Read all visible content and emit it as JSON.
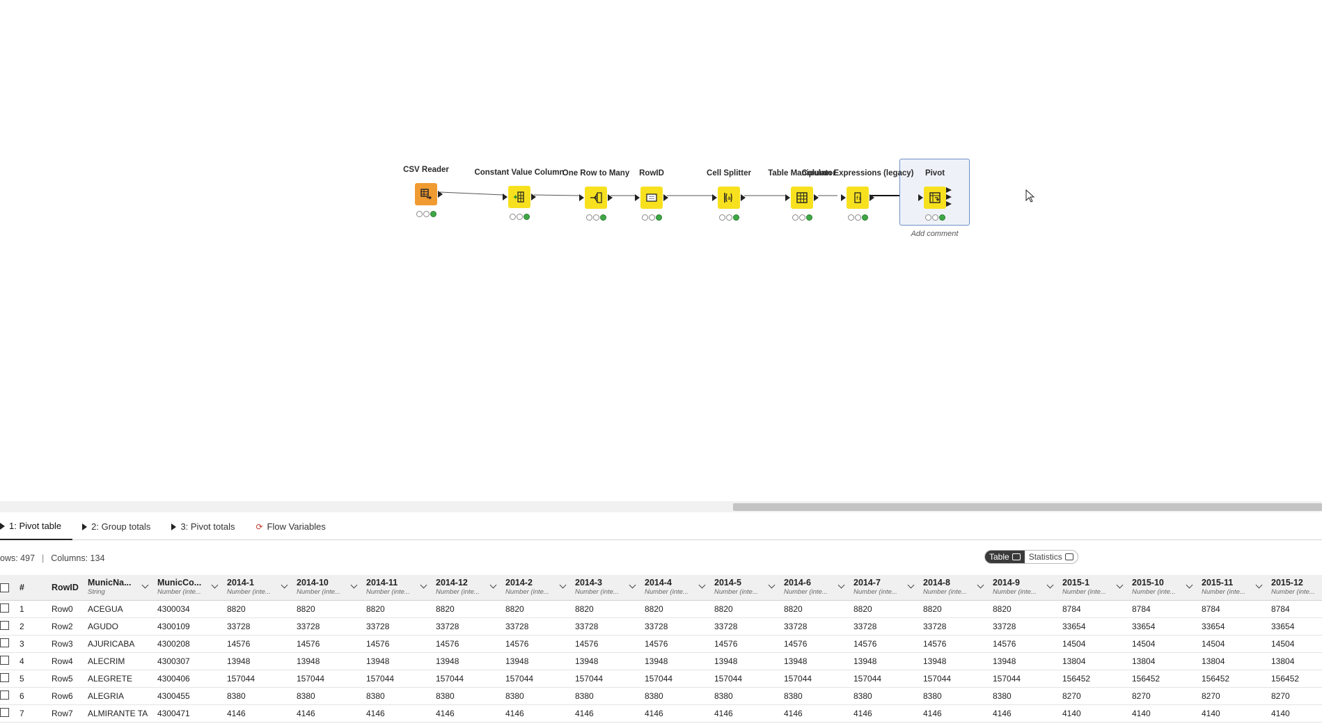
{
  "workflow": {
    "nodes": [
      {
        "id": "csv-reader",
        "title": "CSV Reader",
        "kind": "source",
        "icon": "csv-reader-icon",
        "status": [
          "idle",
          "idle",
          "ok"
        ]
      },
      {
        "id": "constant-value-column",
        "title": "Constant Value Column",
        "kind": "manipulator",
        "icon": "constant-value-icon",
        "status": [
          "idle",
          "idle",
          "ok"
        ]
      },
      {
        "id": "one-row-to-many",
        "title": "One Row to Many",
        "kind": "manipulator",
        "icon": "one-row-to-many-icon",
        "status": [
          "idle",
          "idle",
          "ok"
        ]
      },
      {
        "id": "rowid",
        "title": "RowID",
        "kind": "manipulator",
        "icon": "rowid-icon",
        "status": [
          "idle",
          "idle",
          "ok"
        ]
      },
      {
        "id": "cell-splitter",
        "title": "Cell Splitter",
        "kind": "manipulator",
        "icon": "cell-splitter-icon",
        "status": [
          "idle",
          "idle",
          "ok"
        ]
      },
      {
        "id": "table-manipulator",
        "title": "Table Manipulator",
        "kind": "manipulator",
        "icon": "table-manipulator-icon",
        "status": [
          "idle",
          "idle",
          "ok"
        ]
      },
      {
        "id": "column-expressions",
        "title": "Column Expressions (legacy)",
        "kind": "manipulator",
        "icon": "column-expressions-icon",
        "status": [
          "idle",
          "idle",
          "ok"
        ]
      },
      {
        "id": "pivot",
        "title": "Pivot",
        "kind": "manipulator",
        "icon": "pivot-icon",
        "status": [
          "idle",
          "idle",
          "ok"
        ],
        "selected": true
      }
    ],
    "add_comment": "Add comment"
  },
  "tabs": [
    {
      "label": "1: Pivot table",
      "active": true,
      "icon": "triangle-right-icon"
    },
    {
      "label": "2: Group totals",
      "active": false,
      "icon": "triangle-right-icon"
    },
    {
      "label": "3: Pivot totals",
      "active": false,
      "icon": "triangle-right-icon"
    },
    {
      "label": "Flow Variables",
      "active": false,
      "icon": "flow-variable-icon"
    }
  ],
  "info": {
    "rows": "ows: 497",
    "columns": "Columns: 134",
    "sep": "|"
  },
  "view_toggle": {
    "table": "Table",
    "statistics": "Statistics",
    "selected": "table"
  },
  "table": {
    "columns": [
      {
        "name": "#",
        "type": ""
      },
      {
        "name": "RowID",
        "type": ""
      },
      {
        "name": "MunicNa...",
        "type": "String"
      },
      {
        "name": "MunicCo...",
        "type": "Number (inte..."
      },
      {
        "name": "2014-1",
        "type": "Number (inte..."
      },
      {
        "name": "2014-10",
        "type": "Number (inte..."
      },
      {
        "name": "2014-11",
        "type": "Number (inte..."
      },
      {
        "name": "2014-12",
        "type": "Number (inte..."
      },
      {
        "name": "2014-2",
        "type": "Number (inte..."
      },
      {
        "name": "2014-3",
        "type": "Number (inte..."
      },
      {
        "name": "2014-4",
        "type": "Number (inte..."
      },
      {
        "name": "2014-5",
        "type": "Number (inte..."
      },
      {
        "name": "2014-6",
        "type": "Number (inte..."
      },
      {
        "name": "2014-7",
        "type": "Number (inte..."
      },
      {
        "name": "2014-8",
        "type": "Number (inte..."
      },
      {
        "name": "2014-9",
        "type": "Number (inte..."
      },
      {
        "name": "2015-1",
        "type": "Number (inte..."
      },
      {
        "name": "2015-10",
        "type": "Number (inte..."
      },
      {
        "name": "2015-11",
        "type": "Number (inte..."
      },
      {
        "name": "2015-12",
        "type": "Number (inte..."
      }
    ],
    "rows": [
      [
        "1",
        "Row0",
        "ACEGUA",
        "4300034",
        "8820",
        "8820",
        "8820",
        "8820",
        "8820",
        "8820",
        "8820",
        "8820",
        "8820",
        "8820",
        "8820",
        "8820",
        "8784",
        "8784",
        "8784",
        "8784"
      ],
      [
        "2",
        "Row2",
        "AGUDO",
        "4300109",
        "33728",
        "33728",
        "33728",
        "33728",
        "33728",
        "33728",
        "33728",
        "33728",
        "33728",
        "33728",
        "33728",
        "33728",
        "33654",
        "33654",
        "33654",
        "33654"
      ],
      [
        "3",
        "Row3",
        "AJURICABA",
        "4300208",
        "14576",
        "14576",
        "14576",
        "14576",
        "14576",
        "14576",
        "14576",
        "14576",
        "14576",
        "14576",
        "14576",
        "14576",
        "14504",
        "14504",
        "14504",
        "14504"
      ],
      [
        "4",
        "Row4",
        "ALECRIM",
        "4300307",
        "13948",
        "13948",
        "13948",
        "13948",
        "13948",
        "13948",
        "13948",
        "13948",
        "13948",
        "13948",
        "13948",
        "13948",
        "13804",
        "13804",
        "13804",
        "13804"
      ],
      [
        "5",
        "Row5",
        "ALEGRETE",
        "4300406",
        "157044",
        "157044",
        "157044",
        "157044",
        "157044",
        "157044",
        "157044",
        "157044",
        "157044",
        "157044",
        "157044",
        "157044",
        "156452",
        "156452",
        "156452",
        "156452"
      ],
      [
        "6",
        "Row6",
        "ALEGRIA",
        "4300455",
        "8380",
        "8380",
        "8380",
        "8380",
        "8380",
        "8380",
        "8380",
        "8380",
        "8380",
        "8380",
        "8380",
        "8380",
        "8270",
        "8270",
        "8270",
        "8270"
      ],
      [
        "7",
        "Row7",
        "ALMIRANTE TA",
        "4300471",
        "4146",
        "4146",
        "4146",
        "4146",
        "4146",
        "4146",
        "4146",
        "4146",
        "4146",
        "4146",
        "4146",
        "4146",
        "4140",
        "4140",
        "4140",
        "4140"
      ]
    ]
  },
  "colors": {
    "node_yellow": "#f7e11f",
    "node_orange": "#f09b32",
    "status_ok": "#3ea845",
    "selection_border": "#6d8fc6"
  }
}
